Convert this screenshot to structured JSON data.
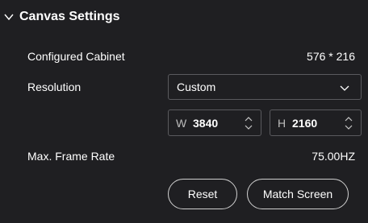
{
  "section": {
    "title": "Canvas Settings",
    "chevron_icon": "chevron-down-icon"
  },
  "configured_cabinet": {
    "label": "Configured Cabinet",
    "value": "576 * 216"
  },
  "resolution": {
    "label": "Resolution",
    "selected": "Custom",
    "width_prefix": "W",
    "width_value": "3840",
    "height_prefix": "H",
    "height_value": "2160"
  },
  "frame_rate": {
    "label": "Max. Frame Rate",
    "value": "75.00HZ"
  },
  "buttons": {
    "reset": "Reset",
    "match_screen": "Match Screen"
  },
  "colors": {
    "background": "#1f1f22",
    "border": "#5a5a5e",
    "text": "#ffffff"
  }
}
